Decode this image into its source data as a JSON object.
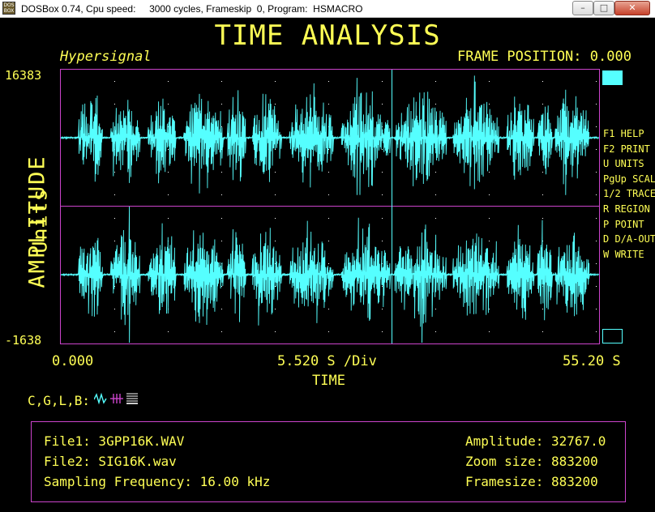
{
  "window": {
    "title": "DOSBox 0.74, Cpu speed:     3000 cycles, Frameskip  0, Program:  HSMACRO",
    "icon_text": "DOS BOX"
  },
  "app": {
    "title": "TIME ANALYSIS",
    "brand": "Hypersignal",
    "frame_position": "FRAME POSITION: 0.000"
  },
  "plot": {
    "y_max_label": "16383",
    "y_min_label": "-1638",
    "y_axis_label_1": "AMPLITUDE",
    "y_axis_label_2": "Units",
    "x_start": "0.000",
    "x_mid": "5.520 S /Div",
    "x_end": "55.20 S",
    "x_axis_label": "TIME",
    "cursor_fraction": 0.615
  },
  "menu": [
    "F1 HELP",
    "F2 PRINT",
    "U UNITS",
    "PgUp SCALE",
    "1/2 TRACE",
    "R REGION",
    "P POINT",
    "D D/A-OUT",
    "W WRITE"
  ],
  "tools": {
    "label": "C,G,L,B:"
  },
  "info": {
    "file1": "File1: 3GPP16K.WAV",
    "file2": "File2: SIG16K.wav",
    "sampling": "Sampling Frequency: 16.00 kHz",
    "amplitude": "Amplitude: 32767.0",
    "zoom": "Zoom size: 883200",
    "framesize": "Framesize: 883200"
  },
  "colors": {
    "waveform": "#55ffff",
    "text": "#ffff55",
    "frame": "#cc44cc",
    "background": "#000000"
  }
}
